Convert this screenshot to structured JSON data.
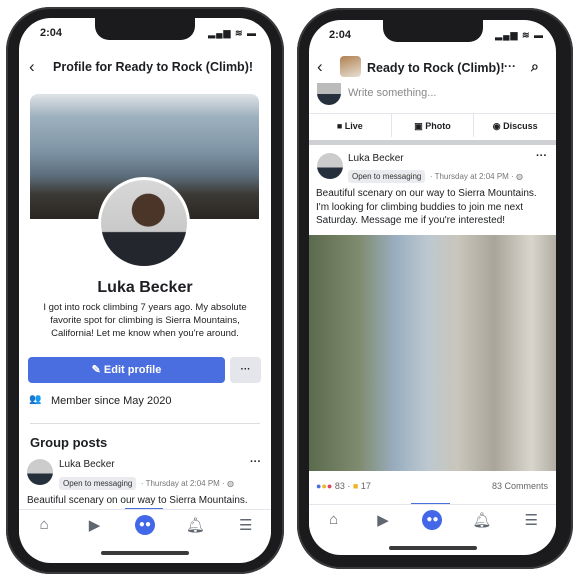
{
  "status": {
    "time": "2:04",
    "signal": "▂▄▆ ≋ ▬"
  },
  "profile": {
    "header_title": "Profile for Ready to Rock (Climb)!",
    "name": "Luka Becker",
    "bio": "I got into rock climbing 7 years ago. My absolute favorite spot for climbing is Sierra Mountains, California! Let me know when you're around.",
    "edit_label": "Edit profile",
    "more_label": "···",
    "member_since": "Member since May 2020",
    "section_title": "Group posts",
    "post": {
      "author": "Luka Becker",
      "chip": "Open to messaging",
      "meta": "· Thursday at 2:04 PM · ◍",
      "text": "Beautiful scenary on our way to Sierra Mountains."
    }
  },
  "group": {
    "header_title": "Ready to Rock (Climb)!",
    "composer_placeholder": "Write something...",
    "actions": [
      {
        "label": "Live",
        "icon": "video-icon"
      },
      {
        "label": "Photo",
        "icon": "photo-icon"
      },
      {
        "label": "Discuss",
        "icon": "messenger-icon"
      }
    ],
    "post": {
      "author": "Luka Becker",
      "chip": "Open to messaging",
      "meta": "· Thursday at 2:04 PM · ◍",
      "text": "Beautiful scenary on our way to Sierra Mountains. I'm looking for climbing buddies to join me next Saturday. Message me if you're interested!"
    },
    "reactions": {
      "count": "83 ·",
      "gifts": "17",
      "comments": "83 Comments"
    }
  },
  "nav": [
    "home-icon",
    "video-icon",
    "groups-icon",
    "bell-icon",
    "menu-icon"
  ],
  "colors": {
    "accent": "#4a6ee0"
  }
}
